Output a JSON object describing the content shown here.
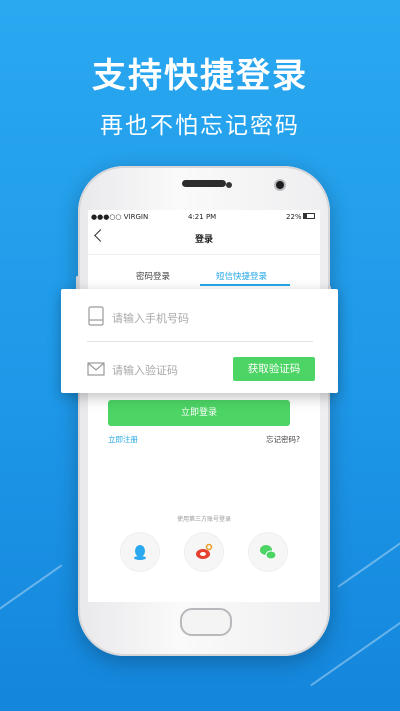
{
  "promo": {
    "headline": "支持快捷登录",
    "subline": "再也不怕忘记密码"
  },
  "status_bar": {
    "carrier": "●●●○○ VIRGIN",
    "time": "4:21 PM",
    "battery": "22%"
  },
  "nav": {
    "title": "登录"
  },
  "tabs": [
    {
      "label": "密码登录",
      "active": false
    },
    {
      "label": "短信快捷登录",
      "active": true
    }
  ],
  "form": {
    "phone_placeholder": "请输入手机号码",
    "code_placeholder": "请输入验证码",
    "get_code_label": "获取验证码",
    "login_label": "立即登录",
    "register_label": "立即注册",
    "forgot_label": "忘记密码?"
  },
  "third_party": {
    "hint": "使用第三方账号登录",
    "providers": [
      "qq-icon",
      "weibo-icon",
      "wechat-icon"
    ]
  },
  "colors": {
    "accent_blue": "#26a8e8",
    "button_green": "#4cd464",
    "background": "#1e98e8"
  }
}
